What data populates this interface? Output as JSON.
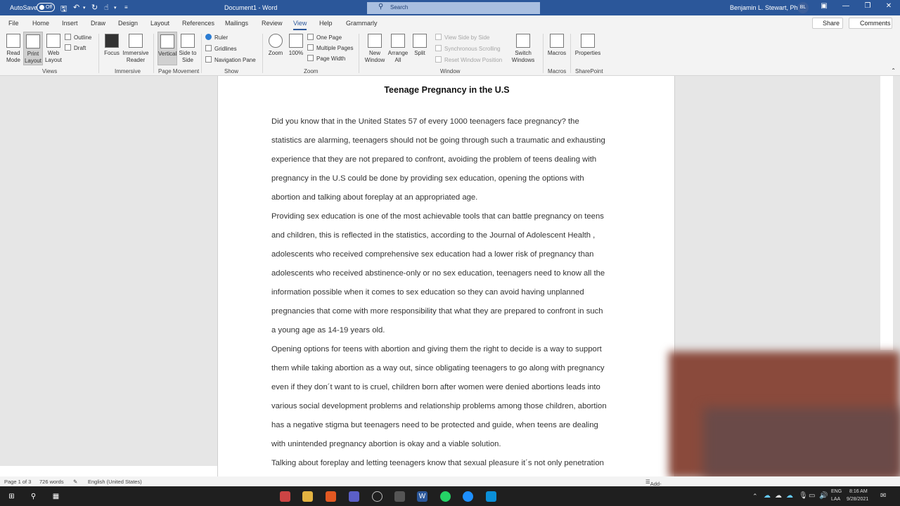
{
  "titlebar": {
    "autosave": "AutoSave",
    "toggle": "Off",
    "doc_title": "Document1 - Word",
    "search": "Search",
    "user": "Benjamin L. Stewart, PhD",
    "initials": "BL"
  },
  "tabs": [
    "File",
    "Home",
    "Insert",
    "Draw",
    "Design",
    "Layout",
    "References",
    "Mailings",
    "Review",
    "View",
    "Help",
    "Grammarly"
  ],
  "active_tab": "View",
  "share": "Share",
  "comments": "Comments",
  "ribbon": {
    "read_mode": "Read Mode",
    "print_layout": "Print Layout",
    "web_layout": "Web Layout",
    "outline": "Outline",
    "draft": "Draft",
    "focus": "Focus",
    "immersive_reader": "Immersive Reader",
    "vertical": "Vertical",
    "side_to_side": "Side to Side",
    "ruler": "Ruler",
    "gridlines": "Gridlines",
    "navigation_pane": "Navigation Pane",
    "zoom": "Zoom",
    "hundred": "100%",
    "one_page": "One Page",
    "multiple_pages": "Multiple Pages",
    "page_width": "Page Width",
    "new_window": "New Window",
    "arrange_all": "Arrange All",
    "split": "Split",
    "view_side_by_side": "View Side by Side",
    "sync_scrolling": "Synchronous Scrolling",
    "reset_window": "Reset Window Position",
    "switch_windows": "Switch Windows",
    "macros": "Macros",
    "properties": "Properties",
    "groups": {
      "views": "Views",
      "immersive": "Immersive",
      "page_movement": "Page Movement",
      "show": "Show",
      "zoom": "Zoom",
      "window": "Window",
      "macros": "Macros",
      "sharepoint": "SharePoint"
    }
  },
  "document": {
    "title": "Teenage Pregnancy in the U.S",
    "lines": [
      "Did you know that in the United States 57 of every 1000 teenagers face pregnancy? the",
      "statistics are alarming, teenagers should not be going through such a traumatic and exhausting",
      "experience that they are not prepared to confront, avoiding the problem of teens dealing with",
      "pregnancy in the U.S could be done by providing sex education, opening the options with",
      "abortion and talking about foreplay at an appropriated age.",
      "Providing sex education is one of the most achievable tools that can battle pregnancy on teens",
      "and children, this is reflected in the statistics, according to the Journal of Adolescent Health ,",
      "adolescents who received comprehensive sex education had a lower risk of pregnancy than",
      "adolescents who received abstinence-only or no sex education, teenagers need to know all the",
      "information possible when it comes to sex education so they can avoid having unplanned",
      "pregnancies that come with more responsibility that what they are prepared to confront in such",
      "a young age as 14-19 years old.",
      "Opening options for teens with abortion and giving them the right to decide is a way to support",
      "them while taking abortion as a way out, since obligating teenagers to go along with pregnancy",
      "even if they don´t want to is cruel, children born after women were denied abortions leads into",
      "various social development problems and relationship problems among those children, abortion",
      "has a negative stigma but teenagers need to be protected and guide, when teens are dealing",
      "with unintended pregnancy abortion is okay and a viable solution.",
      "Talking about foreplay and letting teenagers know that sexual pleasure it´s not only penetration"
    ]
  },
  "status": {
    "page": "Page 1 of 3",
    "words": "726 words",
    "language": "English (United States)",
    "addins": "Add-ins"
  },
  "tray": {
    "lang1": "ENG",
    "lang2": "LAA",
    "time": "8:16 AM",
    "date": "9/28/2021"
  }
}
